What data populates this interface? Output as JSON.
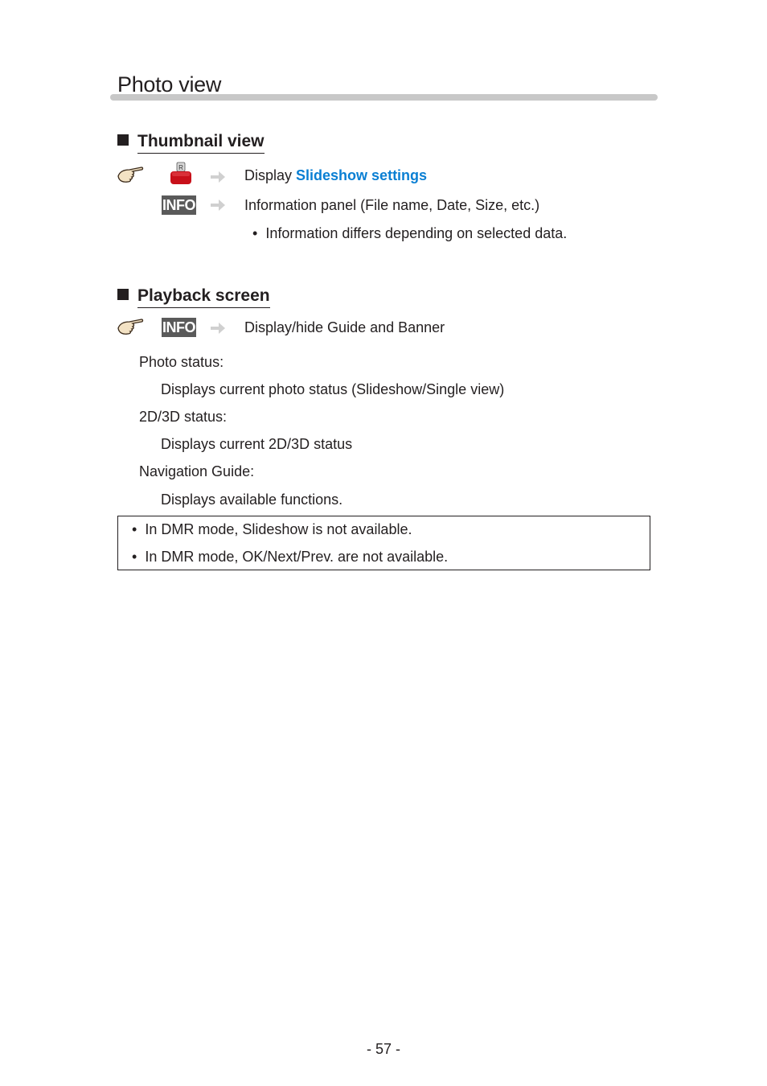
{
  "page": {
    "title": "Photo view",
    "page_number": "- 57 -"
  },
  "thumbnail_view": {
    "heading": "Thumbnail view",
    "rows": [
      {
        "key": "red-button",
        "key_label": "R",
        "text_prefix": "Display ",
        "link": "Slideshow settings"
      },
      {
        "key": "info-button",
        "key_label": "INFO",
        "text": "Information panel (File name, Date, Size, etc.)"
      }
    ],
    "bullet": "Information differs depending on selected data."
  },
  "playback_screen": {
    "heading": "Playback screen",
    "row": {
      "key_label": "INFO",
      "text": "Display/hide Guide and Banner"
    },
    "items": [
      {
        "term": "Photo status:",
        "desc": "Displays current photo status (Slideshow/Single view)"
      },
      {
        "term": "2D/3D status:",
        "desc": "Displays current 2D/3D status"
      },
      {
        "term": "Navigation Guide:",
        "desc": "Displays available functions."
      }
    ]
  },
  "notes": [
    "In DMR mode, Slideshow is not available.",
    "In DMR mode, OK/Next/Prev. are not available."
  ],
  "colors": {
    "link": "#0a7fd3",
    "info_key_bg": "#5a5a5a",
    "red_button": "#c8101a",
    "rule": "#c8c8c8"
  }
}
